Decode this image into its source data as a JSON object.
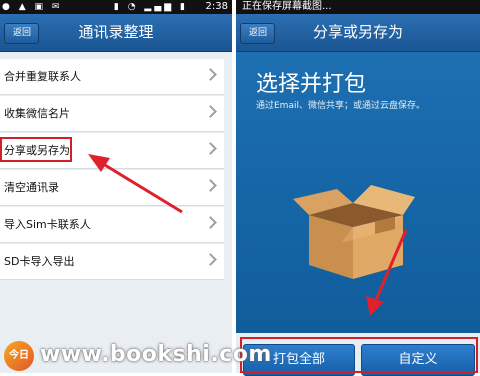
{
  "left_screen": {
    "status_bar": {
      "time": "2:38"
    },
    "header": {
      "back_label": "返回",
      "title": "通讯录整理"
    },
    "items": [
      {
        "label": "合并重复联系人"
      },
      {
        "label": "收集微信名片"
      },
      {
        "label": "分享或另存为"
      },
      {
        "label": "清空通讯录"
      },
      {
        "label": "导入Sim卡联系人"
      },
      {
        "label": "SD卡导入导出"
      }
    ]
  },
  "right_screen": {
    "status_bar": {
      "message": "正在保存屏幕截图..."
    },
    "header": {
      "back_label": "返回",
      "title": "分享或另存为"
    },
    "heading": "选择并打包",
    "subtitle": "通过Email、微信共享；或通过云盘保存。",
    "buttons": [
      {
        "label": "打包全部"
      },
      {
        "label": "自定义"
      }
    ]
  },
  "watermark": {
    "logo_text": "今日",
    "text": "www.bookshi.com"
  },
  "colors": {
    "header_blue": "#1f63a8",
    "highlight_red": "#d0202a",
    "panel_blue": "#1a6aad"
  }
}
